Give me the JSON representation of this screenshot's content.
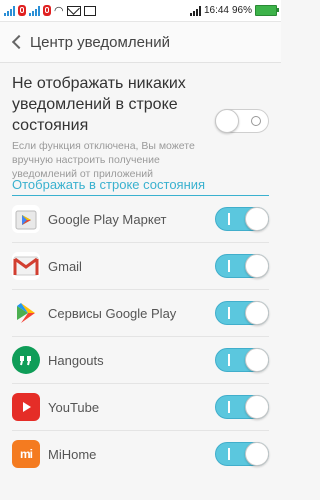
{
  "status_bar": {
    "time": "16:44",
    "battery": "96%"
  },
  "header": {
    "title": "Центр уведомлений"
  },
  "master": {
    "title": "Не отображать никаких уведомлений в строке состояния",
    "description": "Если функция отключена, Вы можете вручную настроить получение уведомлений от приложений",
    "enabled": false
  },
  "section": {
    "title": "Отображать в строке состояния"
  },
  "apps": [
    {
      "label": "Google Play Маркет",
      "icon": "google-play-store-icon",
      "enabled": true
    },
    {
      "label": "Gmail",
      "icon": "gmail-icon",
      "enabled": true
    },
    {
      "label": "Сервисы Google Play",
      "icon": "google-play-services-icon",
      "enabled": true
    },
    {
      "label": "Hangouts",
      "icon": "hangouts-icon",
      "enabled": true
    },
    {
      "label": "YouTube",
      "icon": "youtube-icon",
      "enabled": true
    },
    {
      "label": "MiHome",
      "icon": "mihome-icon",
      "enabled": true
    }
  ],
  "colors": {
    "accent": "#3ab1cf",
    "toggle_on": "#5bc7de"
  }
}
